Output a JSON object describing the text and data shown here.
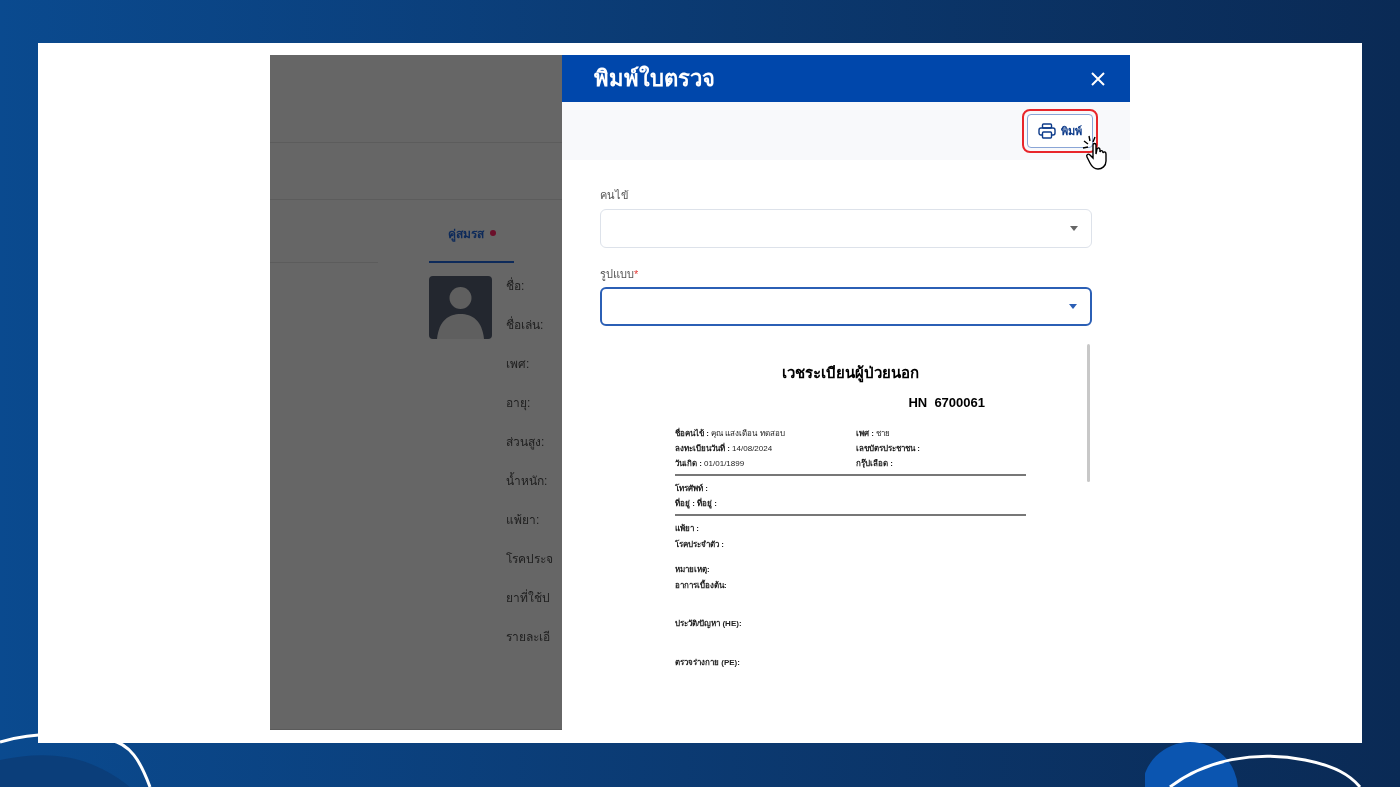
{
  "background_panel": {
    "tabs": [
      {
        "label": "คู่สมรส",
        "selected": true,
        "badge": true
      }
    ],
    "fields": [
      "ชื่อ:",
      "ชื่อเล่น:",
      "เพศ:",
      "อายุ:",
      "ส่วนสูง:",
      "น้ำหนัก:",
      "แพ้ยา:",
      "โรคประจ",
      "ยาที่ใช้ป",
      "รายละเอี"
    ]
  },
  "modal": {
    "title": "พิมพ์ใบตรวจ",
    "print_button": {
      "label": "พิมพ์",
      "highlighted": true
    },
    "selects": [
      {
        "label": "คนไข้",
        "focused": false
      },
      {
        "label": "รูปแบบ",
        "required_mark": "*",
        "focused": true
      }
    ],
    "document": {
      "title": "เวชระเบียนผู้ป่วยนอก",
      "hn": "HN  6700061",
      "info": [
        [
          {
            "label": "ชื่อคนไข้ :",
            "value": "คุณ แสงเดือน ทดสอบ"
          },
          {
            "label": "เพศ :",
            "value": "ชาย"
          }
        ],
        [
          {
            "label": "ลงทะเบียนวันที่ :",
            "value": "14/08/2024"
          },
          {
            "label": "เลขบัตรประชาชน :"
          }
        ],
        [
          {
            "label": "วันเกิด :",
            "value": "01/01/1899"
          },
          {
            "label": "กรุ๊ปเลือด :"
          }
        ]
      ],
      "contact": [
        "โทรศัพท์ :",
        "ที่อยู่ : ที่อยู่ :"
      ],
      "groups": [
        [
          "แพ้ยา :",
          "โรคประจำตัว :"
        ],
        [
          "หมายเหตุ:",
          "อาการเบื้องต้น:"
        ],
        [
          "ประวัติ/ปัญหา (HE):"
        ],
        [
          "ตรวจร่างกาย (PE):"
        ]
      ]
    }
  }
}
